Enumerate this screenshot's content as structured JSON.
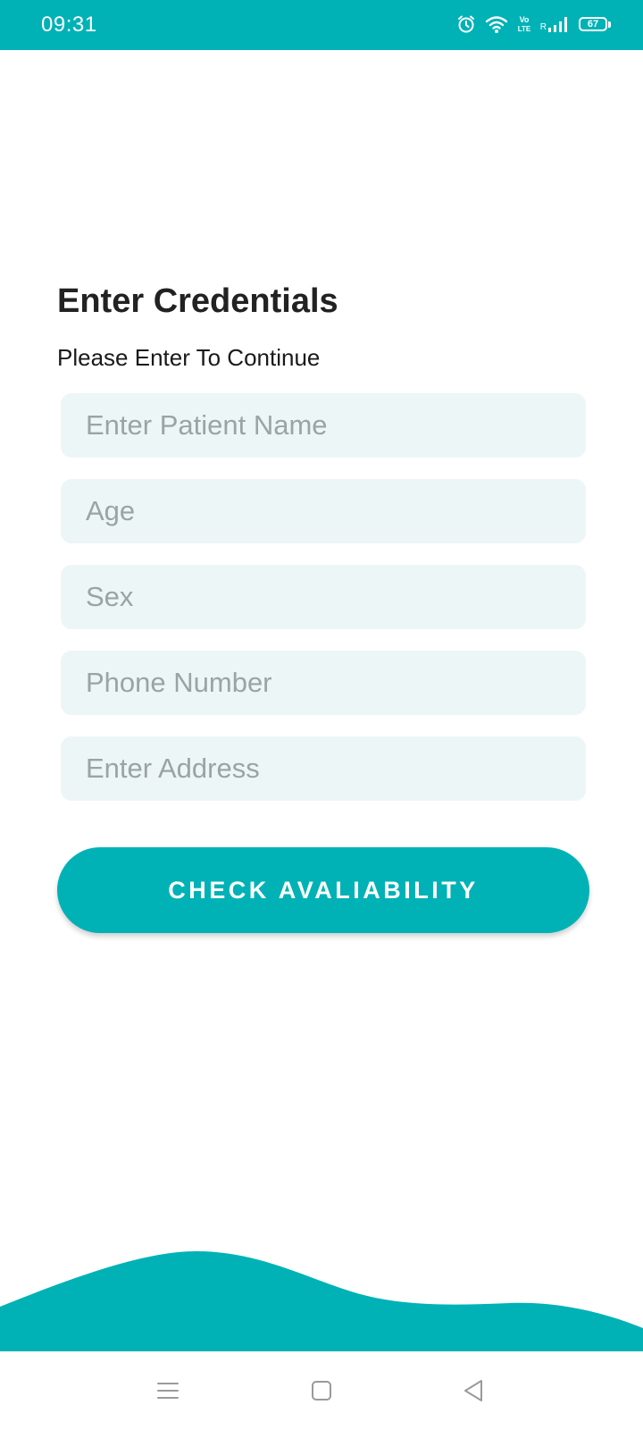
{
  "status_bar": {
    "time": "09:31",
    "volte_label": "Vo\nLTE",
    "roaming_label": "R",
    "battery_level": "67"
  },
  "form": {
    "title": "Enter Credentials",
    "subtitle": "Please Enter To Continue",
    "fields": [
      {
        "placeholder": "Enter Patient Name",
        "value": ""
      },
      {
        "placeholder": "Age",
        "value": ""
      },
      {
        "placeholder": "Sex",
        "value": ""
      },
      {
        "placeholder": "Phone Number",
        "value": ""
      },
      {
        "placeholder": "Enter Address",
        "value": ""
      }
    ],
    "submit_label": "CHECK AVALIABILITY"
  },
  "nav": {
    "icons": [
      "menu-icon",
      "home-square-icon",
      "back-triangle-icon"
    ]
  },
  "colors": {
    "accent": "#00b2b6",
    "field_background": "#edf6f7",
    "placeholder": "#9aa3a6"
  }
}
